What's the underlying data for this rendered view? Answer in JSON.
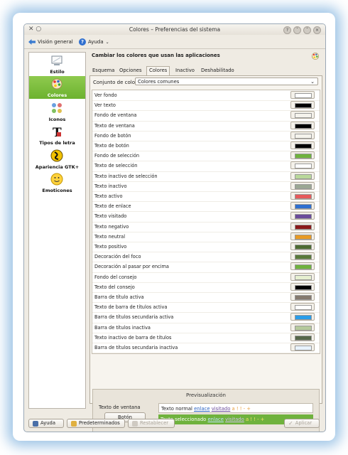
{
  "window": {
    "title": "Colores – Preferencias del sistema"
  },
  "toolbar": {
    "overview_label": "Visión general",
    "help_label": "Ayuda"
  },
  "sidebar": {
    "items": [
      {
        "label": "Estilo"
      },
      {
        "label": "Colores"
      },
      {
        "label": "Iconos"
      },
      {
        "label": "Tipos de letra"
      },
      {
        "label": "Apariencia GTK+"
      },
      {
        "label": "Emoticones"
      }
    ]
  },
  "header": {
    "title": "Cambiar los colores que usan las aplicaciones"
  },
  "tabs": [
    {
      "label": "Esquema"
    },
    {
      "label": "Opciones"
    },
    {
      "label": "Colores"
    },
    {
      "label": "Inactivo"
    },
    {
      "label": "Deshabilitado"
    }
  ],
  "scheme": {
    "label": "Conjunto de color:",
    "value": "Colores comunes"
  },
  "colors": {
    "rows": [
      {
        "label": "Ver fondo",
        "color": "#ffffff"
      },
      {
        "label": "Ver texto",
        "color": "#000000"
      },
      {
        "label": "Fondo de ventana",
        "color": "#f5f3ec"
      },
      {
        "label": "Texto de ventana",
        "color": "#000000"
      },
      {
        "label": "Fondo de botón",
        "color": "#f5f3ec"
      },
      {
        "label": "Texto de botón",
        "color": "#000000"
      },
      {
        "label": "Fondo de selección",
        "color": "#6fb23d"
      },
      {
        "label": "Texto de selección",
        "color": "#ffffff"
      },
      {
        "label": "Texto inactivo de selección",
        "color": "#b9d89a"
      },
      {
        "label": "Texto inactivo",
        "color": "#9ba793"
      },
      {
        "label": "Texto activo",
        "color": "#e65a5a"
      },
      {
        "label": "Texto de enlace",
        "color": "#2f6fcf"
      },
      {
        "label": "Texto visitado",
        "color": "#6a4b9a"
      },
      {
        "label": "Texto negativo",
        "color": "#8b1a1a"
      },
      {
        "label": "Texto neutral",
        "color": "#e89a23"
      },
      {
        "label": "Texto positivo",
        "color": "#4e6b32"
      },
      {
        "label": "Decoración del foco",
        "color": "#5a7a3a"
      },
      {
        "label": "Decoración al pasar por encima",
        "color": "#6fb23d"
      },
      {
        "label": "Fondo del consejo",
        "color": "#e6f0d0"
      },
      {
        "label": "Texto del consejo",
        "color": "#000000"
      },
      {
        "label": "Barra de título activa",
        "color": "#857a6e"
      },
      {
        "label": "Texto de barra de títulos activa",
        "color": "#ffffff"
      },
      {
        "label": "Barra de títulos secundaria activa",
        "color": "#2a9de8"
      },
      {
        "label": "Barra de títulos inactiva",
        "color": "#b5c99c"
      },
      {
        "label": "Texto inactivo de barra de títulos",
        "color": "#56674a"
      },
      {
        "label": "Barra de títulos secundaria inactiva",
        "color": "#e8f2fc"
      }
    ]
  },
  "preview": {
    "title": "Previsualización",
    "window_text_label": "Texto de ventana",
    "button_label": "Botón",
    "normal_text": "Texto normal",
    "link_text": "enlace",
    "visited_text": "visitado",
    "extra_marks": "a ! ! - +",
    "selected_text": "Texto seleccionado",
    "selected_link": "enlace",
    "selected_visited": "visitado",
    "selected_marks": "a ! ! - +"
  },
  "bottom": {
    "help_label": "Ayuda",
    "defaults_label": "Predeterminados",
    "reset_label": "Restablecer",
    "apply_label": "Aplicar"
  }
}
